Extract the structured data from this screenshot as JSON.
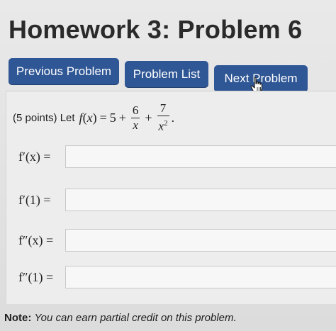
{
  "page": {
    "title": "Homework 3: Problem 6"
  },
  "nav": {
    "previous_label": "Previous Problem",
    "list_label": "Problem List",
    "next_label": "Next Problem"
  },
  "problem": {
    "points_text": "(5 points) Let",
    "func_name": "f",
    "var": "x",
    "equals": "=",
    "const": "5",
    "plus": "+",
    "frac1_num": "6",
    "frac1_den": "x",
    "frac2_num": "7",
    "frac2_den": "x",
    "frac2_den_exp": "2",
    "period": "."
  },
  "answers": [
    {
      "label": "f′(x) =",
      "value": ""
    },
    {
      "label": "f′(1) =",
      "value": ""
    },
    {
      "label": "f″(x) =",
      "value": ""
    },
    {
      "label": "f″(1) =",
      "value": ""
    }
  ],
  "footer": {
    "note_label": "Note:",
    "note_text": "You can earn partial credit on this problem."
  },
  "colors": {
    "button_bg": "#2f5695",
    "button_text": "#ffffff",
    "page_bg": "#e4e4e4"
  },
  "icons": {
    "cursor": "hand-pointer-icon"
  }
}
